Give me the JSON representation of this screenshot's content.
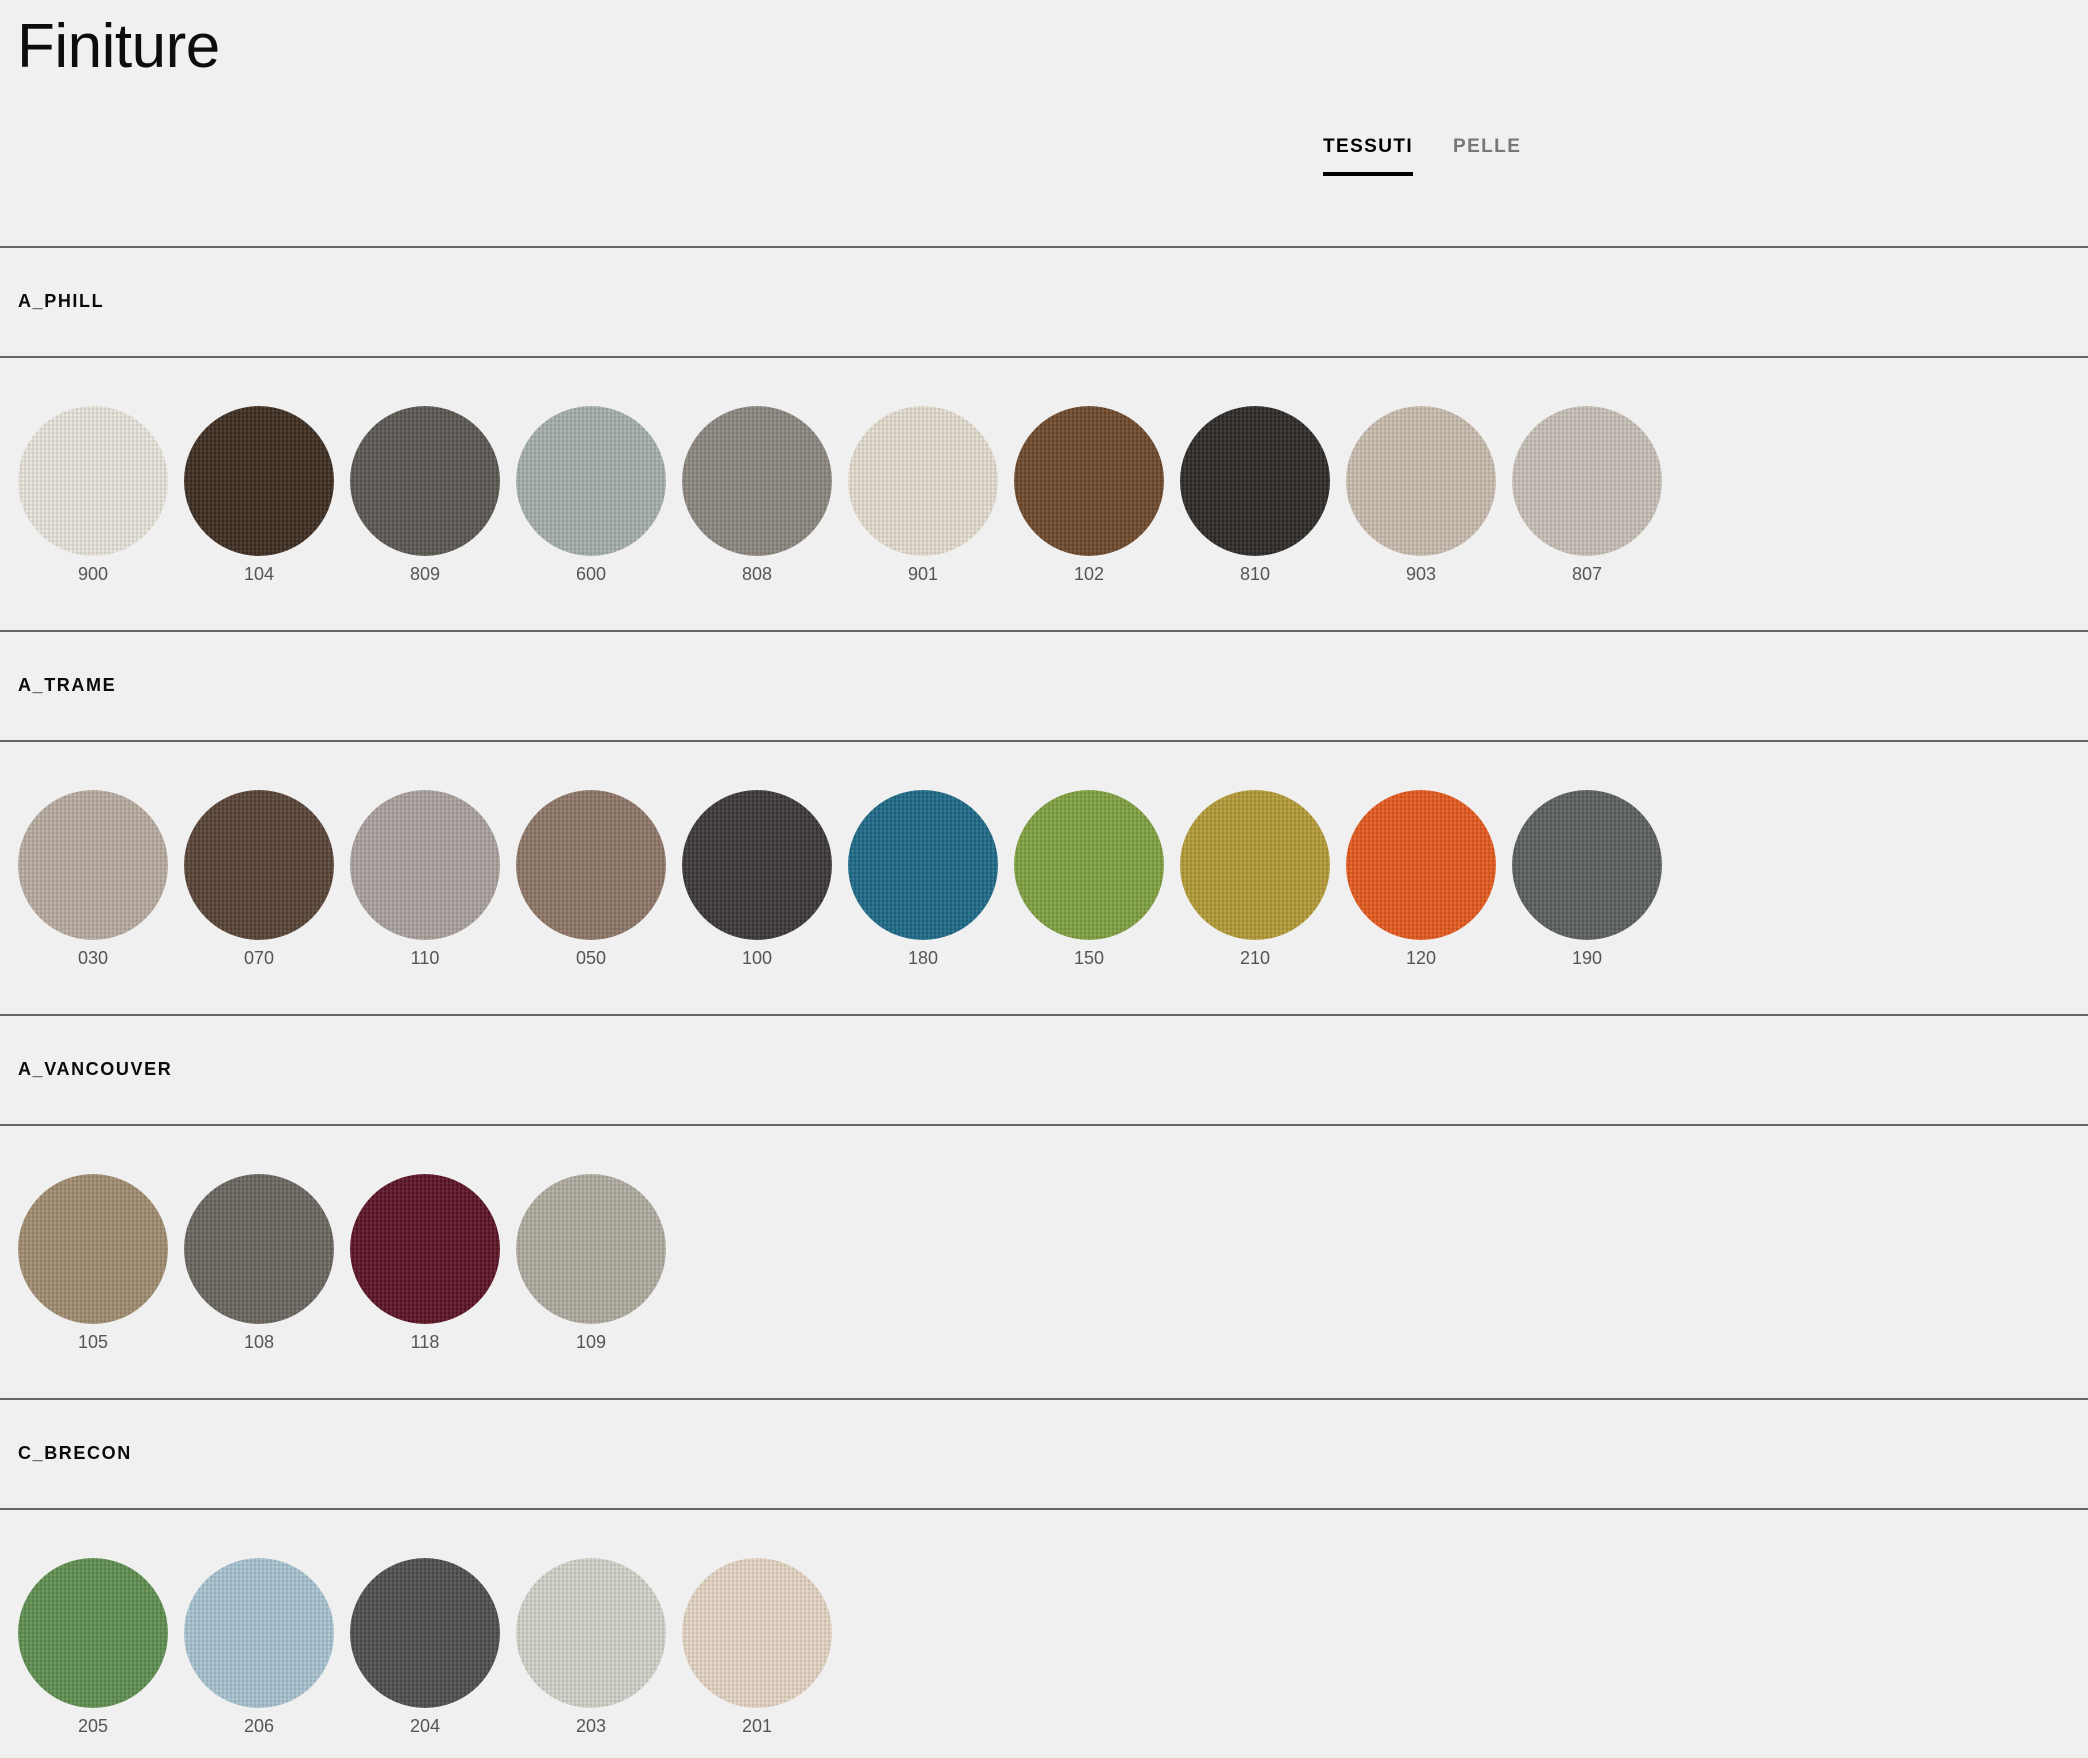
{
  "page": {
    "title": "Finiture"
  },
  "tabs": [
    {
      "label": "TESSUTI",
      "active": true
    },
    {
      "label": "PELLE",
      "active": false
    }
  ],
  "sections": [
    {
      "title": "A_PHILL",
      "swatches": [
        {
          "code": "900",
          "color": "#e9e5dc"
        },
        {
          "code": "104",
          "color": "#3f2e22"
        },
        {
          "code": "809",
          "color": "#5c5853"
        },
        {
          "code": "600",
          "color": "#a5b0ab"
        },
        {
          "code": "808",
          "color": "#8d8780"
        },
        {
          "code": "901",
          "color": "#e5ddd0"
        },
        {
          "code": "102",
          "color": "#6f4a2c"
        },
        {
          "code": "810",
          "color": "#2e2b29"
        },
        {
          "code": "903",
          "color": "#c9bdaf"
        },
        {
          "code": "807",
          "color": "#c8c1b7"
        }
      ]
    },
    {
      "title": "A_TRAME",
      "swatches": [
        {
          "code": "030",
          "color": "#b8aca1"
        },
        {
          "code": "070",
          "color": "#5a4438"
        },
        {
          "code": "110",
          "color": "#a9a19d"
        },
        {
          "code": "050",
          "color": "#8f7768"
        },
        {
          "code": "100",
          "color": "#3c3838"
        },
        {
          "code": "180",
          "color": "#1e6a88"
        },
        {
          "code": "150",
          "color": "#80a041"
        },
        {
          "code": "210",
          "color": "#b49b37"
        },
        {
          "code": "120",
          "color": "#e55a1e"
        },
        {
          "code": "190",
          "color": "#5d6060"
        }
      ]
    },
    {
      "title": "A_VANCOUVER",
      "swatches": [
        {
          "code": "105",
          "color": "#a18d71"
        },
        {
          "code": "108",
          "color": "#6b6660"
        },
        {
          "code": "118",
          "color": "#5c1426"
        },
        {
          "code": "109",
          "color": "#b1aca1"
        }
      ]
    },
    {
      "title": "C_BRECON",
      "swatches": [
        {
          "code": "205",
          "color": "#5f8f4f"
        },
        {
          "code": "206",
          "color": "#a8c4d1"
        },
        {
          "code": "204",
          "color": "#4f4f4f"
        },
        {
          "code": "203",
          "color": "#d3d2ca"
        },
        {
          "code": "201",
          "color": "#e5d5c4"
        }
      ]
    }
  ]
}
